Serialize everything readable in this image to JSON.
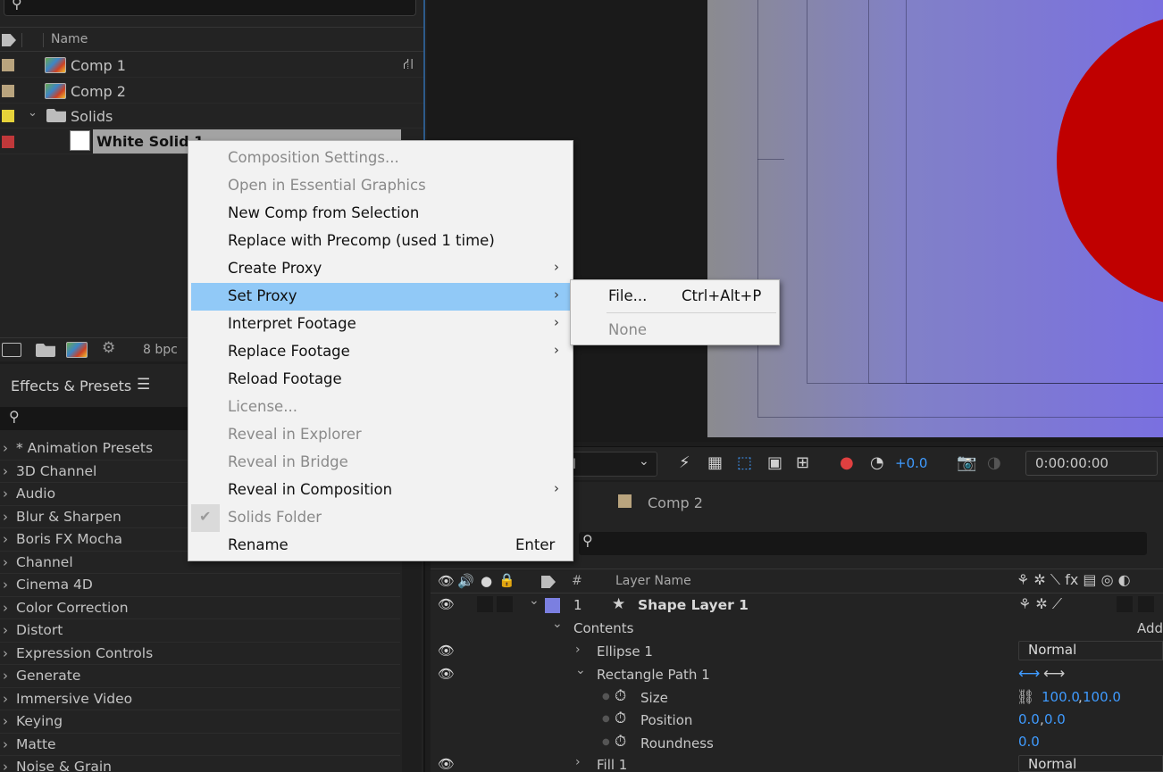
{
  "project": {
    "column_name": "Name",
    "items": [
      {
        "name": "Comp 1",
        "color": "#b9a47e"
      },
      {
        "name": "Comp 2",
        "color": "#b9a47e"
      },
      {
        "name": "Solids",
        "color": "#e6d23a"
      },
      {
        "name": "White Solid 1",
        "color": "#c0383a"
      }
    ],
    "bpc": "8 bpc"
  },
  "effects": {
    "title": "Effects & Presets",
    "menu_icon": "☰",
    "categories": [
      "* Animation Presets",
      "3D Channel",
      "Audio",
      "Blur & Sharpen",
      "Boris FX Mocha",
      "Channel",
      "Cinema 4D",
      "Color Correction",
      "Distort",
      "Expression Controls",
      "Generate",
      "Immersive Video",
      "Keying",
      "Matte",
      "Noise & Grain"
    ]
  },
  "viewer": {
    "exposure": "+0.0",
    "timecode": "0:00:00:00",
    "resolution_partial": "l"
  },
  "timeline": {
    "tab_label": "Comp 2",
    "tab_color": "#b9a47e",
    "col_hash": "#",
    "col_layer_name": "Layer Name",
    "layer": {
      "index": "1",
      "name": "Shape Layer 1",
      "label_color": "#7b7fe0"
    },
    "contents_label": "Contents",
    "add_label": "Add",
    "ellipse": {
      "name": "Ellipse 1",
      "mode": "Normal"
    },
    "rect_path": "Rectangle Path 1",
    "size": {
      "label": "Size",
      "value_a": "100.0",
      "value_b": "100.0"
    },
    "position": {
      "label": "Position",
      "value_a": "0.0",
      "value_b": "0.0"
    },
    "roundness": {
      "label": "Roundness",
      "value": "0.0"
    },
    "fill": {
      "name": "Fill 1",
      "mode": "Normal"
    }
  },
  "context_menu": {
    "items": [
      {
        "label": "Composition Settings...",
        "disabled": true
      },
      {
        "label": "Open in Essential Graphics",
        "disabled": true
      },
      {
        "label": "New Comp from Selection"
      },
      {
        "label": "Replace with Precomp (used 1 time)"
      },
      {
        "label": "Create Proxy",
        "submenu": true
      },
      {
        "label": "Set Proxy",
        "submenu": true,
        "highlighted": true
      },
      {
        "label": "Interpret Footage",
        "submenu": true
      },
      {
        "label": "Replace Footage",
        "submenu": true
      },
      {
        "label": "Reload Footage"
      },
      {
        "label": "License...",
        "disabled": true
      },
      {
        "label": "Reveal in Explorer",
        "disabled": true
      },
      {
        "label": "Reveal in Bridge",
        "disabled": true
      },
      {
        "label": "Reveal in Composition",
        "submenu": true
      },
      {
        "label": "Solids Folder",
        "disabled": true,
        "checked": true
      },
      {
        "label": "Rename",
        "shortcut": "Enter"
      }
    ],
    "submenu": [
      {
        "label": "File...",
        "shortcut": "Ctrl+Alt+P"
      },
      {
        "label": "None",
        "disabled": true
      }
    ]
  }
}
